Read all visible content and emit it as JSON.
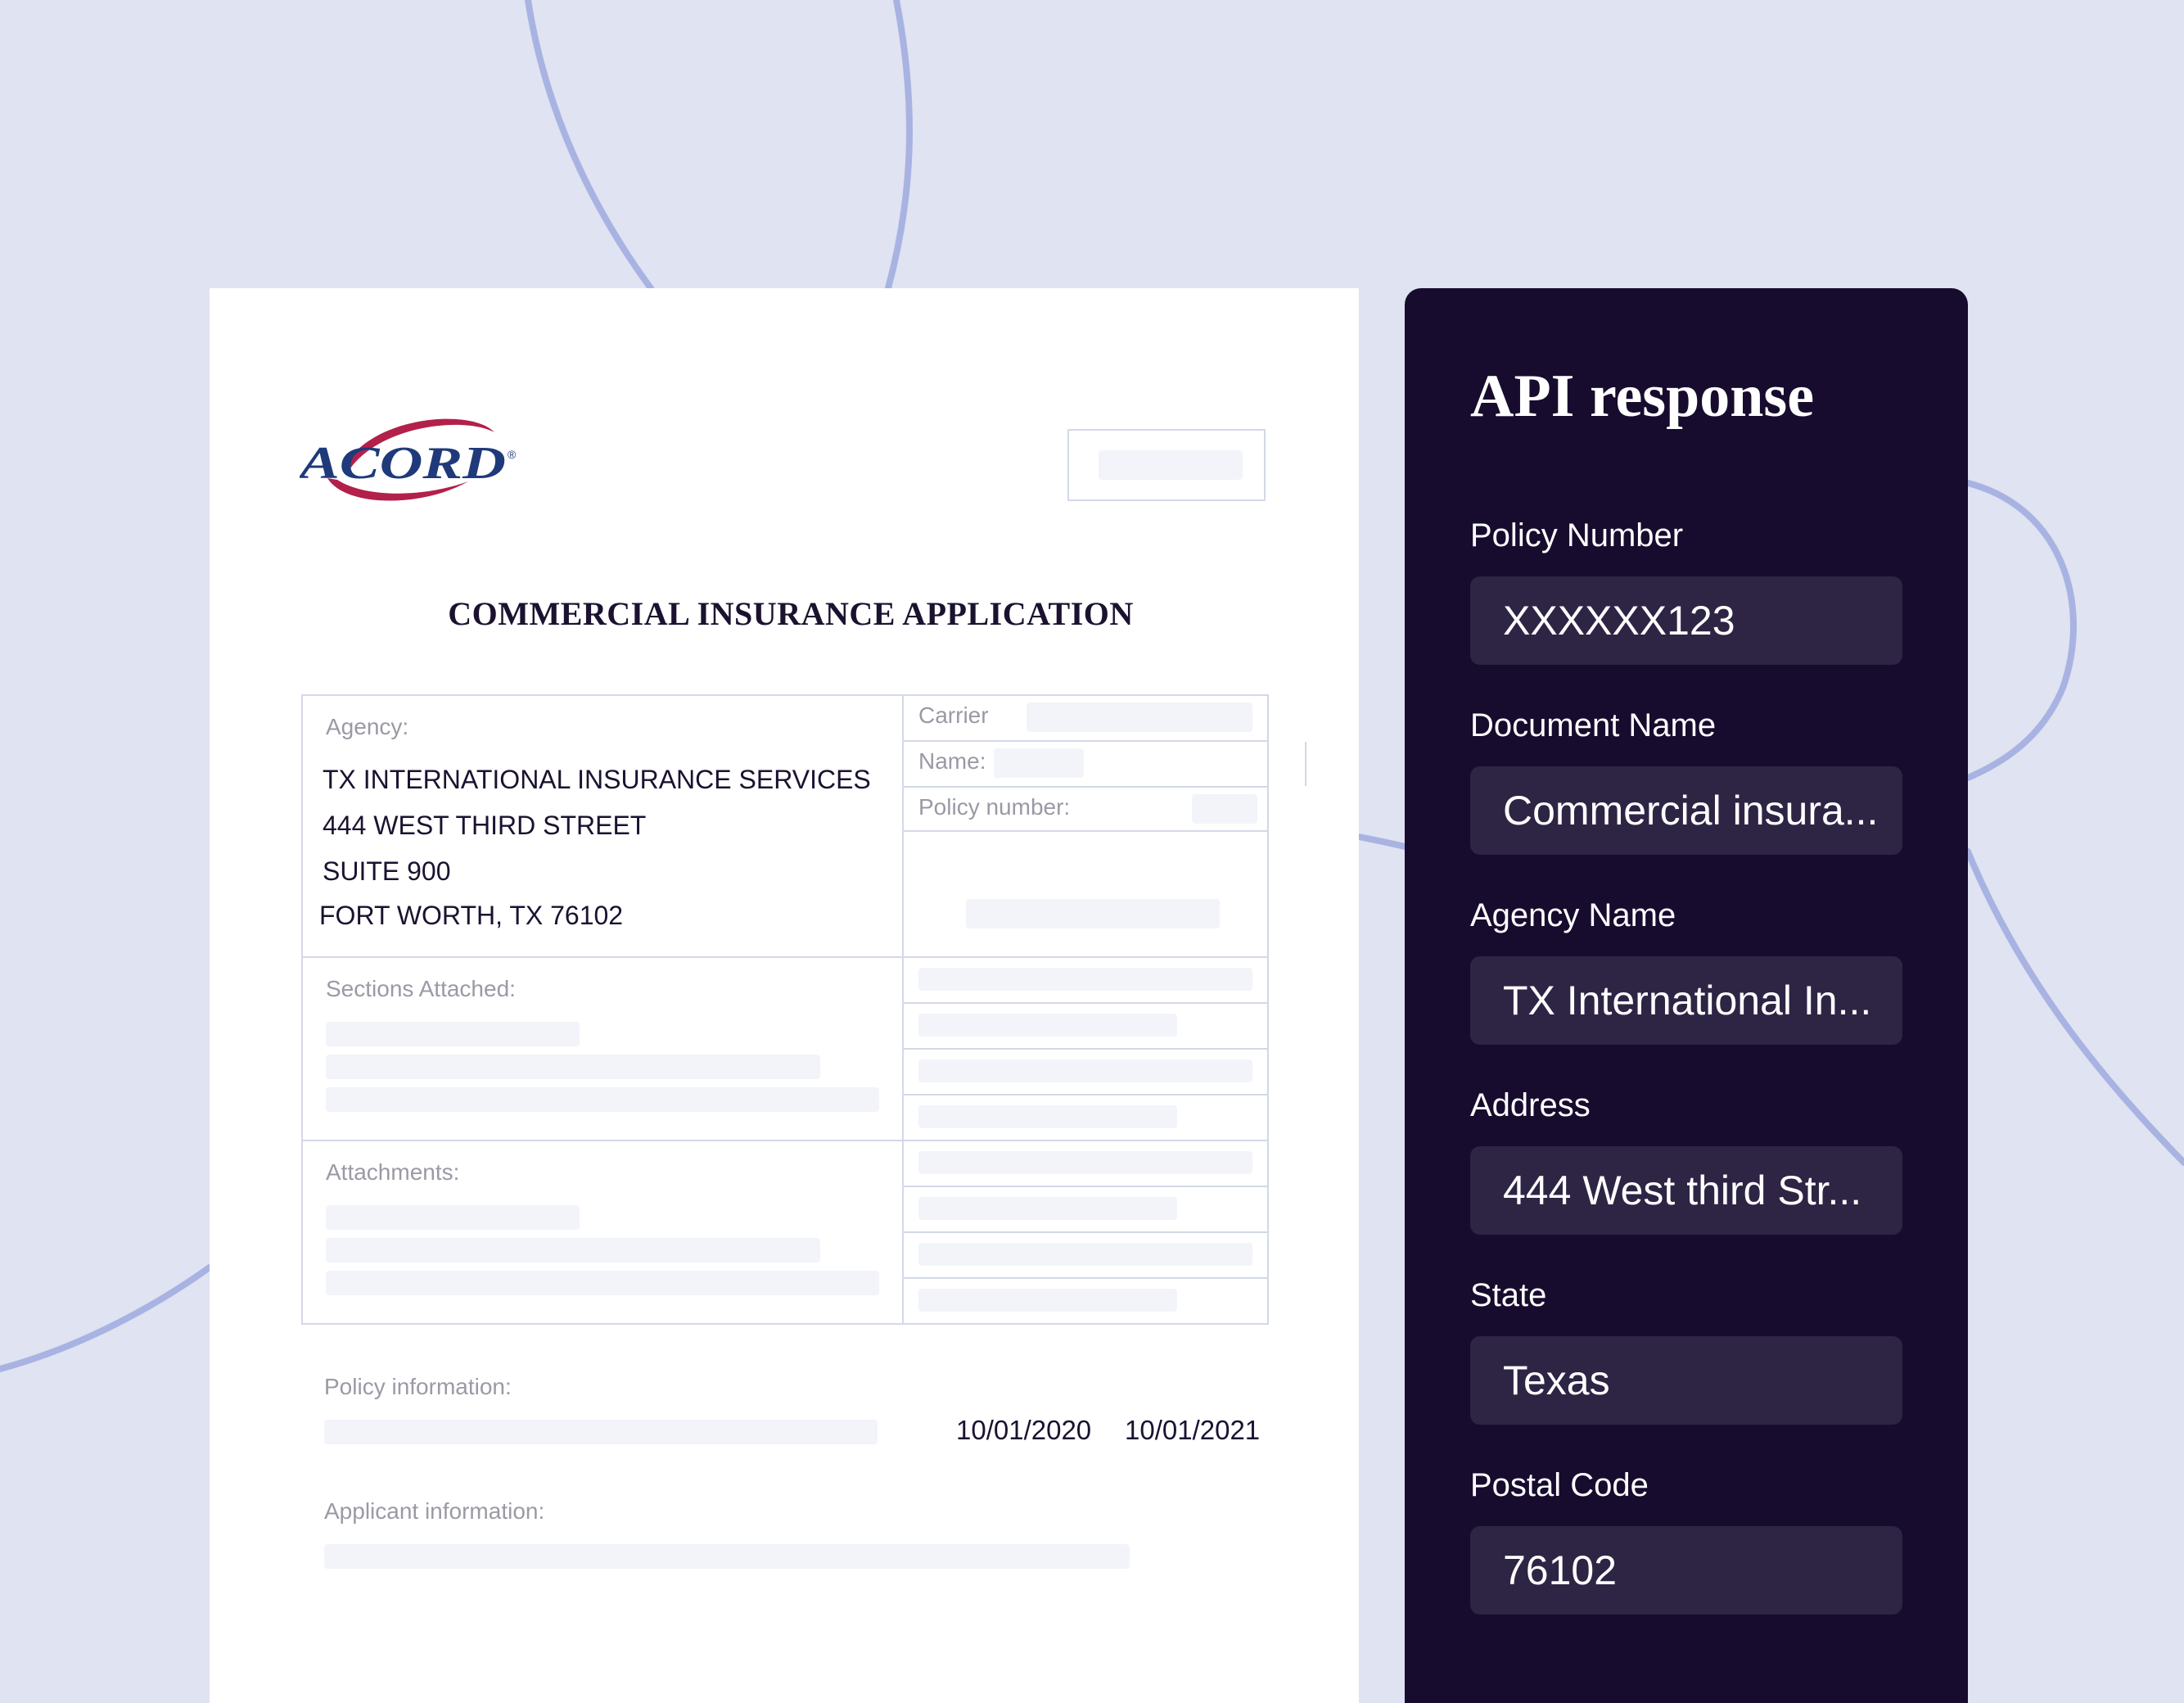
{
  "document": {
    "title": "COMMERCIAL INSURANCE APPLICATION",
    "logo_text": "ACORD",
    "logo_mark": "®",
    "agency_label": "Agency:",
    "agency_lines": [
      "TX INTERNATIONAL INSURANCE SERVICES",
      "444 WEST THIRD STREET",
      "SUITE 900",
      "FORT WORTH, TX 76102"
    ],
    "carrier_label": "Carrier",
    "name_label": "Name:",
    "policy_number_label": "Policy number:",
    "sections_attached_label": "Sections Attached:",
    "attachments_label": "Attachments:",
    "policy_information_label": "Policy information:",
    "effective_date": "10/01/2020",
    "expiration_date": "10/01/2021",
    "applicant_information_label": "Applicant information:"
  },
  "api_response": {
    "title": "API response",
    "fields": [
      {
        "label": "Policy Number",
        "value": "XXXXXX123"
      },
      {
        "label": "Document Name",
        "value": "Commercial insura..."
      },
      {
        "label": "Agency Name",
        "value": "TX International In..."
      },
      {
        "label": "Address",
        "value": "444 West third Str..."
      },
      {
        "label": "State",
        "value": "Texas"
      },
      {
        "label": "Postal Code",
        "value": "76102"
      }
    ]
  },
  "colors": {
    "background": "#dfe3f2",
    "curve": "#a9b3e2",
    "panel": "#170c2e",
    "field_box": "#2e2545",
    "logo_blue": "#1f3a7a",
    "logo_red": "#b3204a"
  }
}
